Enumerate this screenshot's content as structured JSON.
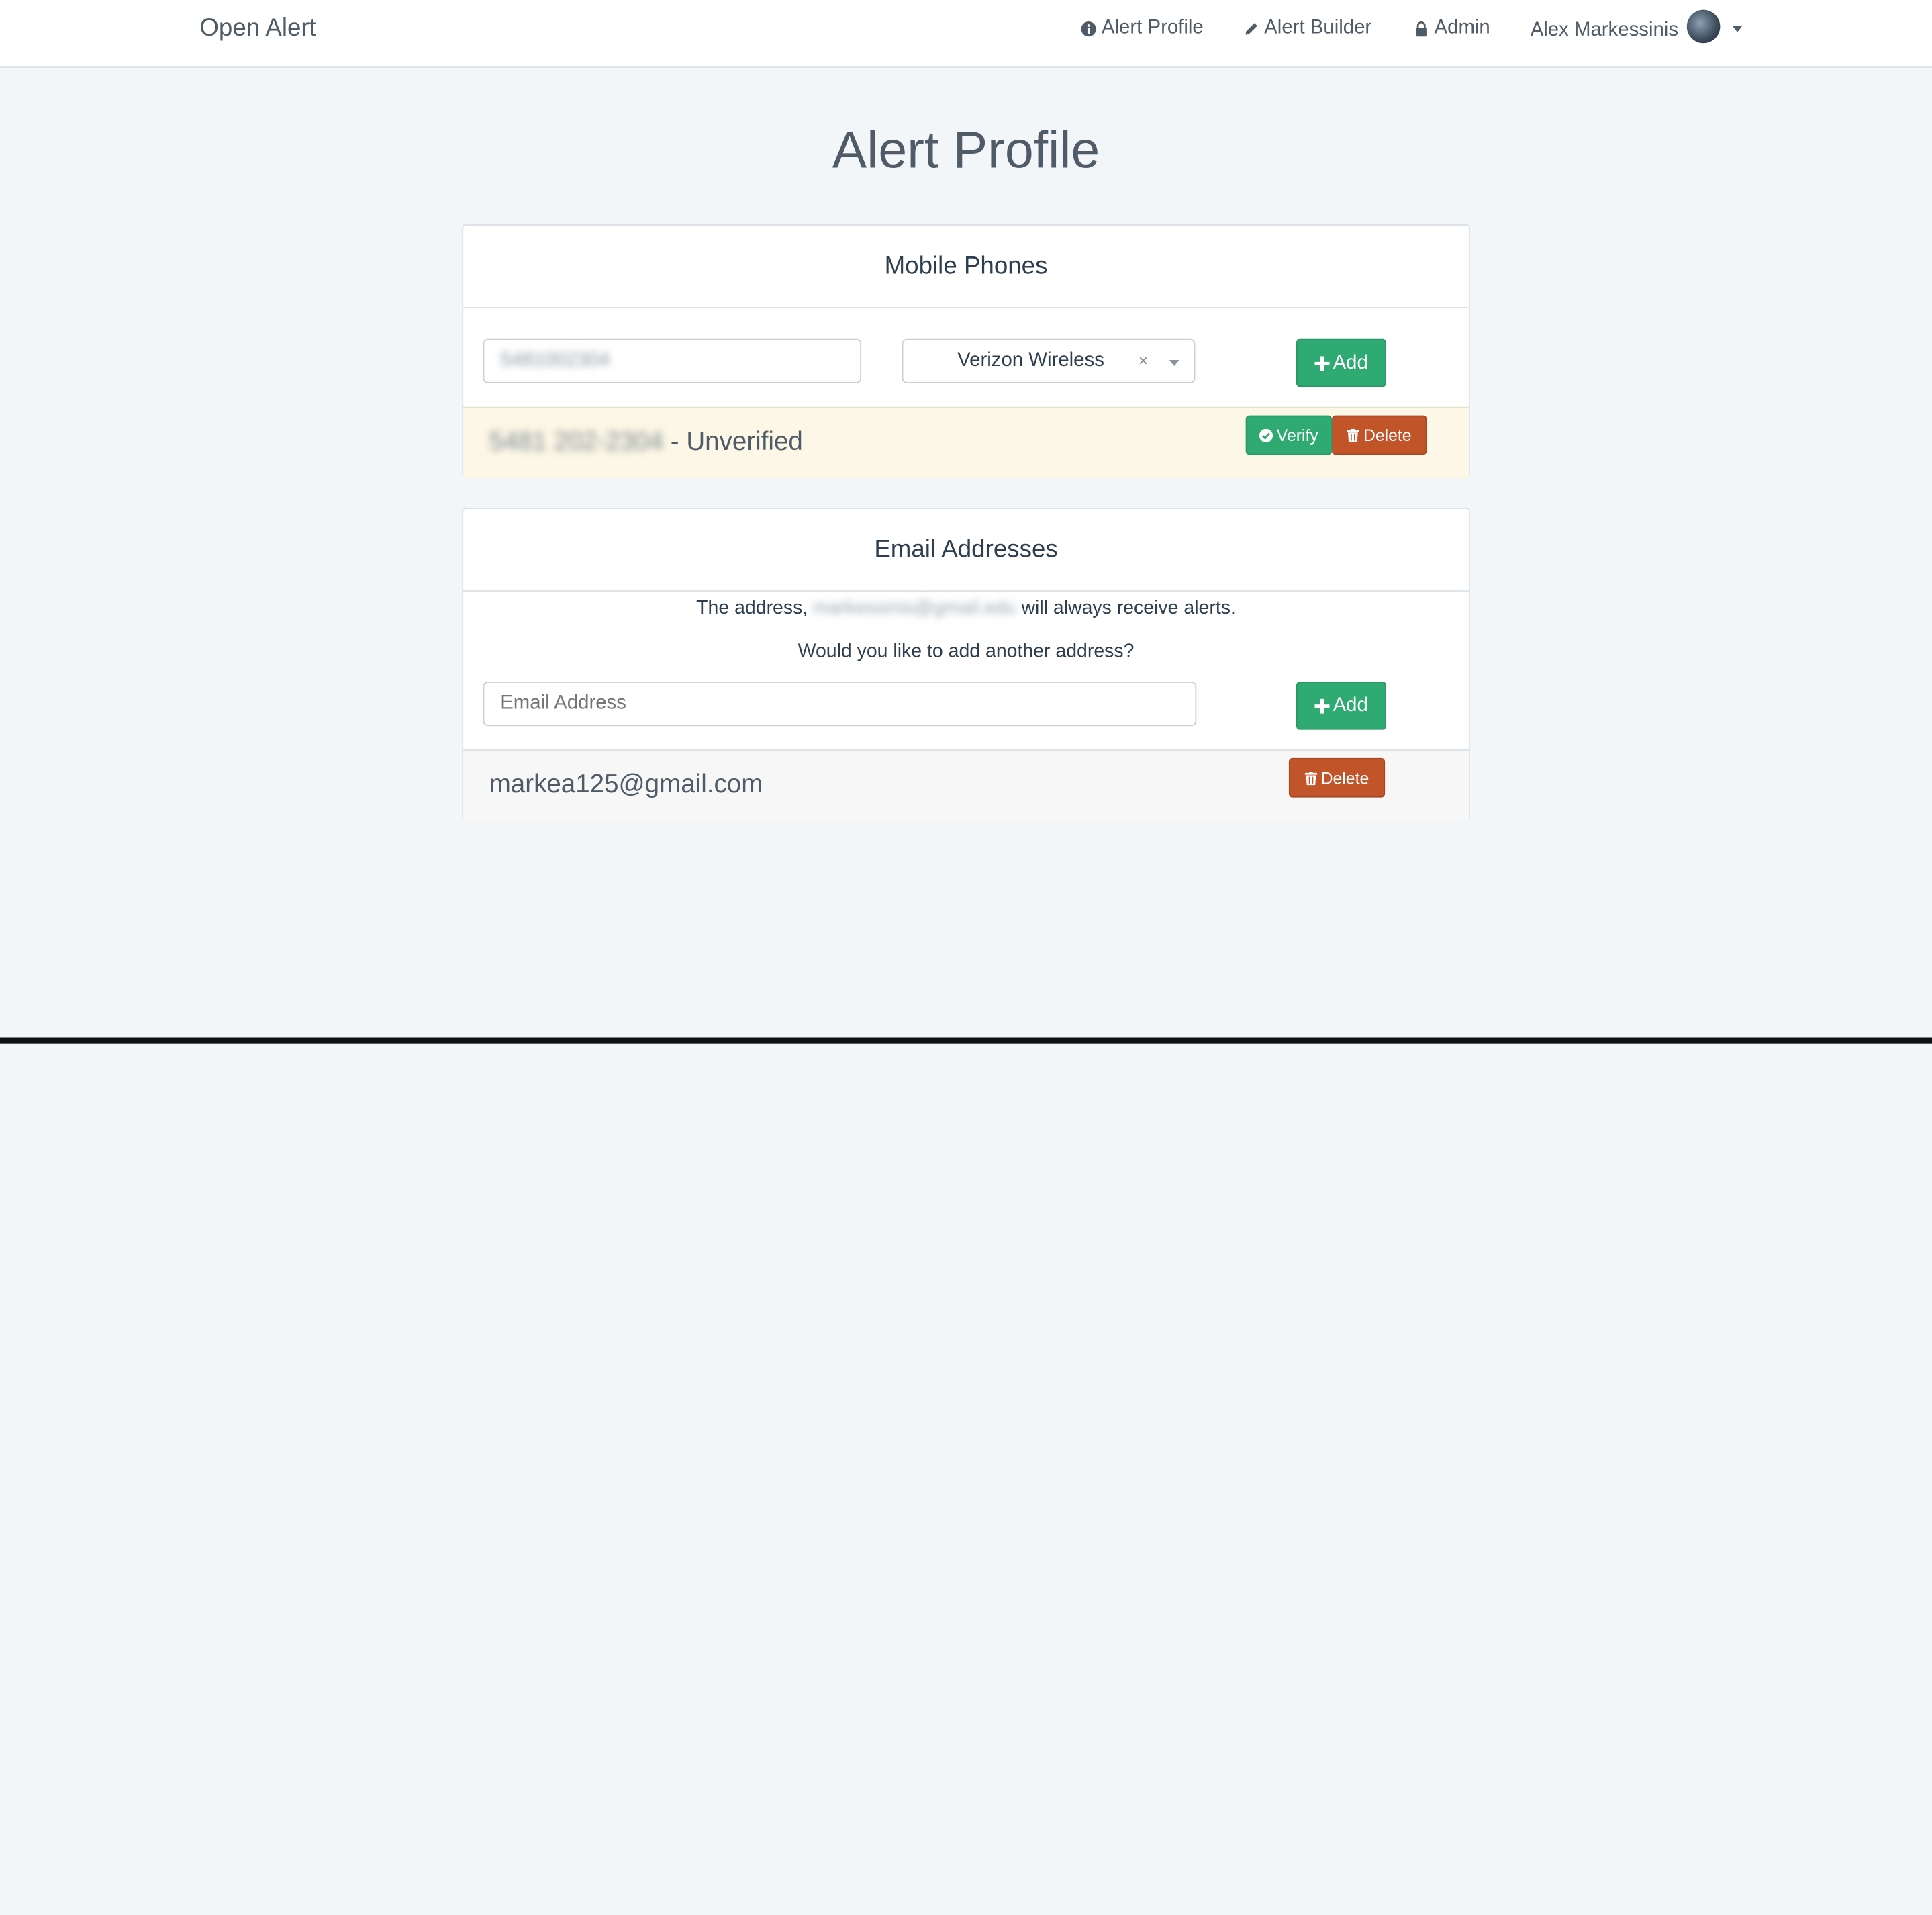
{
  "navbar": {
    "brand": "Open Alert",
    "items": [
      {
        "label": "Alert Profile",
        "icon": "info-circle-icon"
      },
      {
        "label": "Alert Builder",
        "icon": "pencil-icon"
      },
      {
        "label": "Admin",
        "icon": "lock-icon"
      }
    ],
    "user": {
      "name": "Alex Markessinis"
    }
  },
  "page": {
    "title": "Alert Profile"
  },
  "phones": {
    "heading": "Mobile Phones",
    "number_value": "5481002304",
    "carrier": "Verizon Wireless",
    "clear_glyph": "×",
    "add_label": "Add",
    "entries": [
      {
        "number": "5481 202-2304",
        "status": "- Unverified",
        "verify_label": "Verify",
        "delete_label": "Delete"
      }
    ]
  },
  "emails": {
    "heading": "Email Addresses",
    "notice_prefix": "The address,",
    "notice_address": "markessinis@gmail.edu",
    "notice_suffix": "will always receive alerts.",
    "prompt": "Would you like to add another address?",
    "placeholder": "Email Address",
    "add_label": "Add",
    "entries": [
      {
        "address": "markea125@gmail.com",
        "delete_label": "Delete"
      }
    ]
  },
  "colors": {
    "success": "#2eaa72",
    "danger": "#c2542a",
    "warning_row": "#fcf7e6",
    "background": "#f3f6f9"
  }
}
